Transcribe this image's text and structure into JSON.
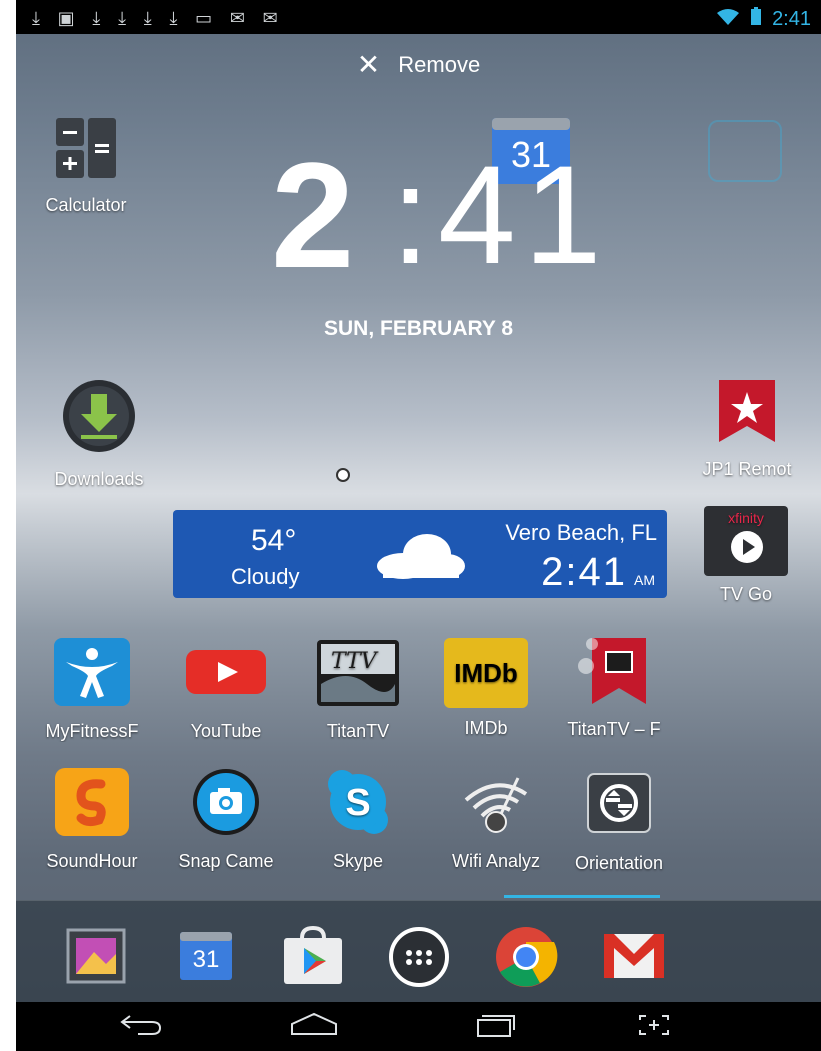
{
  "status_bar": {
    "notification_icons": "⤓ ▣ ⤓ ⤓ ⤓ ⤓ ▭ ✉ ✉",
    "time": "2:41"
  },
  "remove_bar": {
    "label": "Remove"
  },
  "clock": {
    "hour": "2",
    "minute": ":41"
  },
  "date": "SUN, FEBRUARY 8",
  "calendar_widget": {
    "day": "31"
  },
  "weather": {
    "temperature": "54°",
    "condition": "Cloudy",
    "location": "Vero Beach, FL",
    "time": "2:41",
    "ampm": "AM"
  },
  "apps": {
    "calculator": "Calculator",
    "downloads": "Downloads",
    "jp1": "JP1 Remot",
    "tvgo": "TV Go",
    "tvgo_brand": "xfinity",
    "myfitness": "MyFitnessF",
    "youtube": "YouTube",
    "titantv": "TitanTV",
    "imdb": "IMDb",
    "imdb_logo": "IMDb",
    "titantv_widget": "TitanTV – F",
    "soundhound": "SoundHour",
    "snapcamera": "Snap Came",
    "skype": "Skype",
    "wifi": "Wifi Analyz",
    "orientation": "Orientation"
  },
  "dock": {
    "calendar_day": "31"
  },
  "colors": {
    "accent": "#33b5e5",
    "weather_bg": "#1e58b3"
  }
}
